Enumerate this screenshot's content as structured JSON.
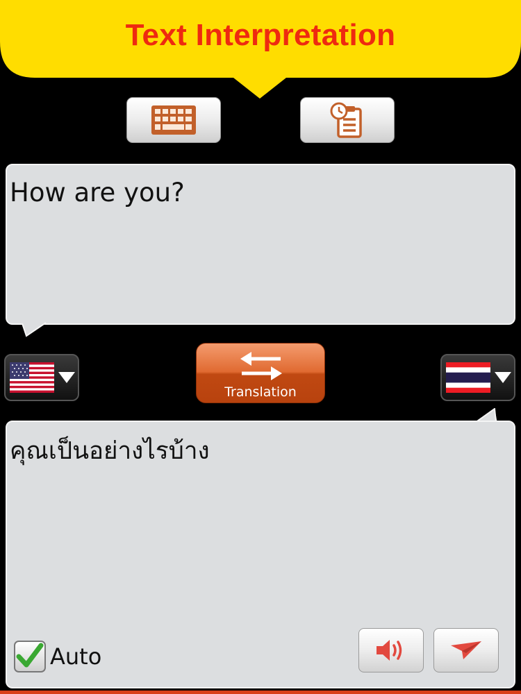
{
  "header": {
    "title": "Text Interpretation"
  },
  "toolbar": {
    "keyboard_icon": "keyboard-icon",
    "history_icon": "clipboard-history-icon"
  },
  "source": {
    "text": "How are you?",
    "language_flag": "us-flag-icon"
  },
  "target": {
    "text": "คุณเป็นอย่างไรบ้าง",
    "language_flag": "thailand-flag-icon"
  },
  "translate": {
    "label": "Translation",
    "icon": "swap-arrows-icon"
  },
  "auto": {
    "label": "Auto",
    "checked": true
  },
  "actions": {
    "speak_icon": "speaker-icon",
    "send_icon": "paper-plane-icon"
  },
  "colors": {
    "header_bg": "#ffdd00",
    "title": "#ee2a10",
    "accent": "#d9531a",
    "panel_bg": "#dcdee0"
  }
}
